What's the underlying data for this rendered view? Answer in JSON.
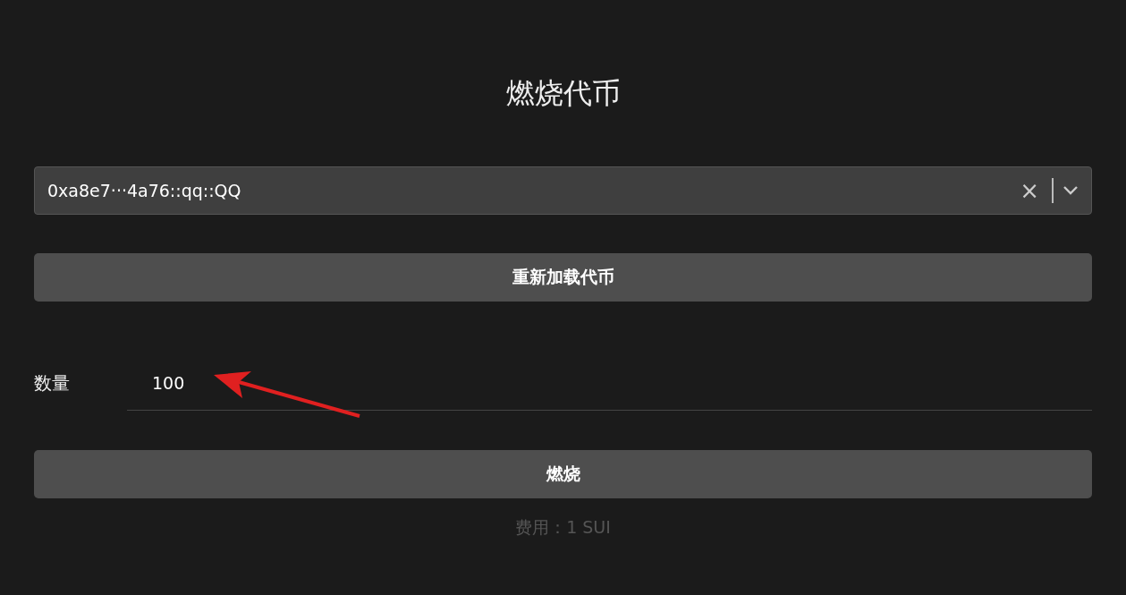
{
  "title": "燃烧代币",
  "token_select": {
    "value": "0xa8e7···4a76::qq::QQ",
    "clear_icon": "×"
  },
  "reload_button": {
    "label": "重新加载代币"
  },
  "amount": {
    "label": "数量",
    "value": "100"
  },
  "annotation": {
    "kind": "arrow"
  },
  "burn_button": {
    "label": "燃烧"
  },
  "fee": "费用：1 SUI"
}
